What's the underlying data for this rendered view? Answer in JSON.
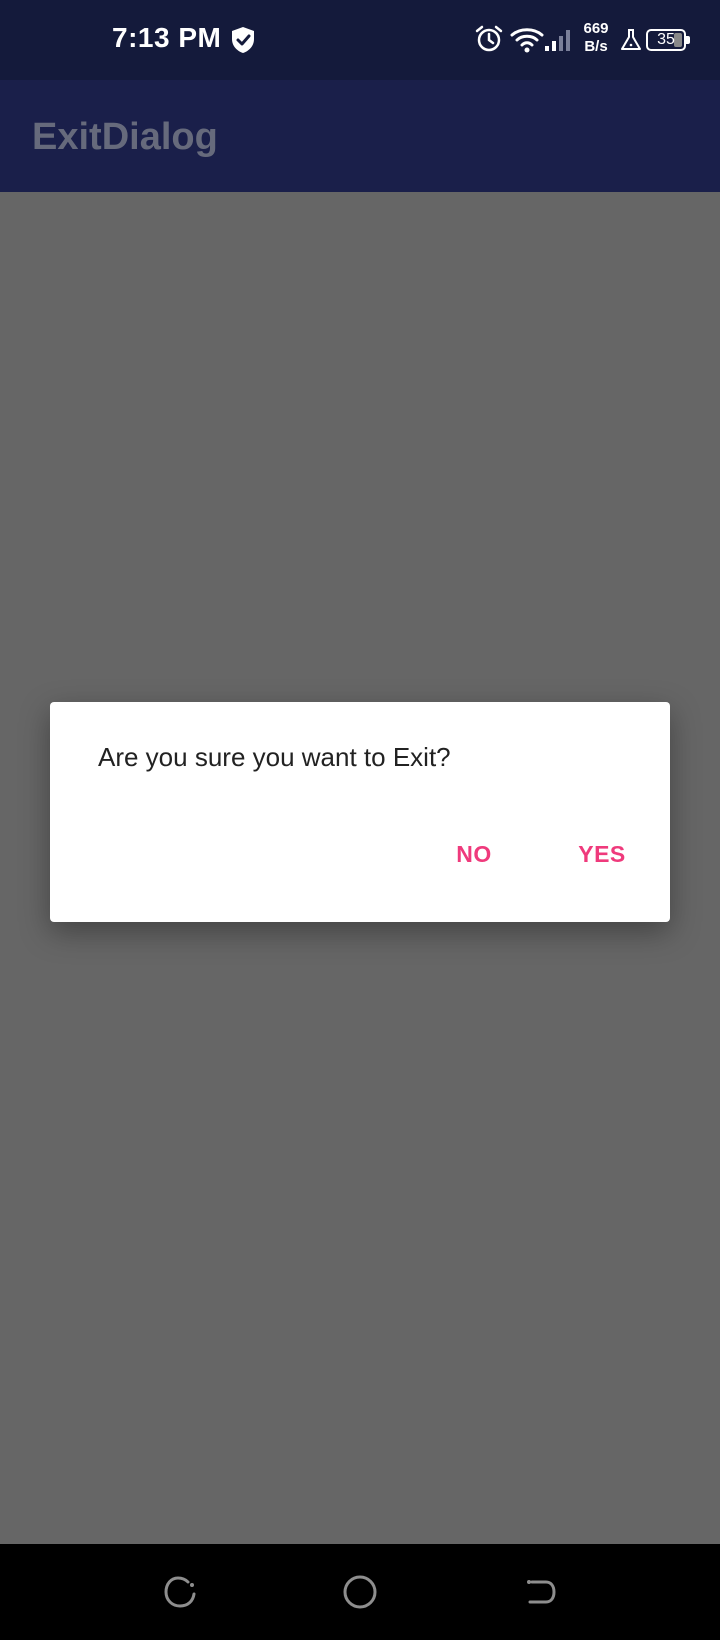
{
  "status_bar": {
    "time": "7:13 PM",
    "net_speed_value": "669",
    "net_speed_unit": "B/s",
    "battery_level": "35"
  },
  "app_bar": {
    "title": "ExitDialog"
  },
  "dialog": {
    "message": "Are you sure you want to Exit?",
    "negative_label": "NO",
    "positive_label": "YES"
  },
  "colors": {
    "status_bar_bg": "#141a3b",
    "app_bar_bg": "#1a1f4a",
    "scrim": "#666666",
    "accent": "#ef3a7c"
  },
  "icons": {
    "status": [
      "shield-icon",
      "alarm-icon",
      "wifi-icon",
      "signal-icon",
      "flask-icon",
      "battery-icon"
    ],
    "navigation": [
      "recent-apps-icon",
      "home-icon",
      "back-icon"
    ]
  }
}
